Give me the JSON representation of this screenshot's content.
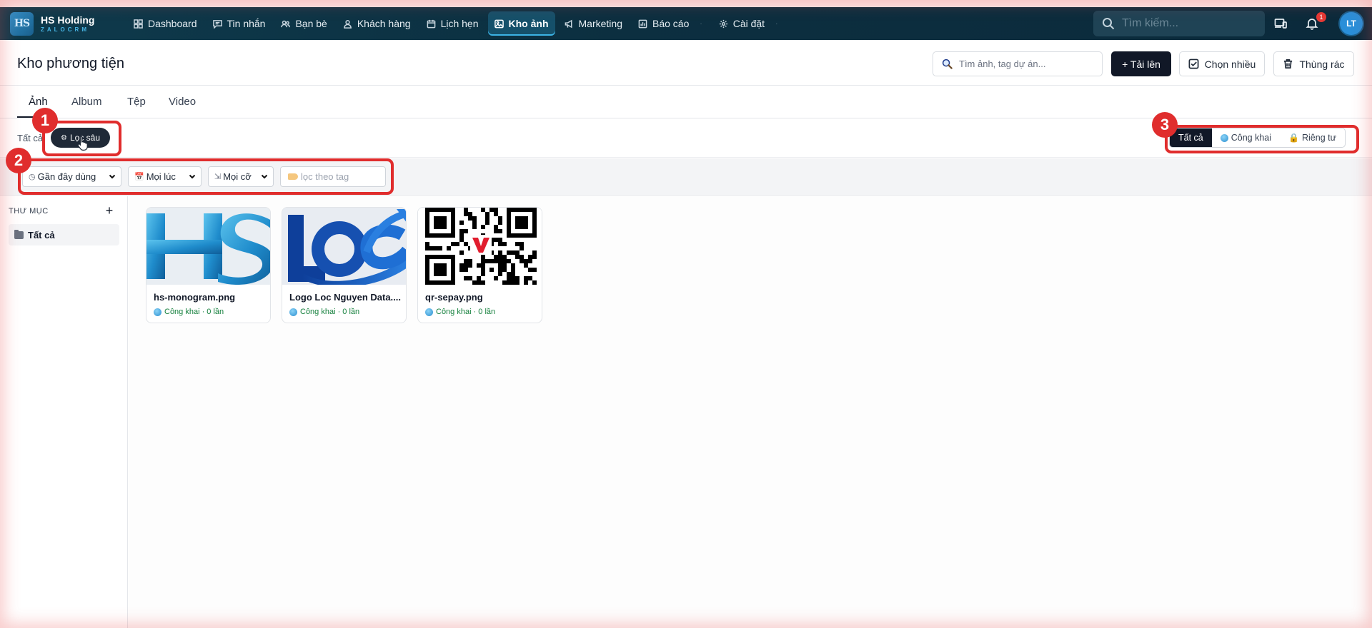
{
  "brand": {
    "logo_text": "HS",
    "name": "HS Holding",
    "sub": "ZALOCRM"
  },
  "nav": {
    "items": [
      {
        "label": "Dashboard",
        "icon": "grid-icon"
      },
      {
        "label": "Tin nhắn",
        "icon": "message-icon"
      },
      {
        "label": "Bạn bè",
        "icon": "friends-icon"
      },
      {
        "label": "Khách hàng",
        "icon": "user-icon"
      },
      {
        "label": "Lịch hẹn",
        "icon": "calendar-icon"
      },
      {
        "label": "Kho ảnh",
        "icon": "image-icon",
        "active": true
      },
      {
        "label": "Marketing",
        "icon": "megaphone-icon"
      },
      {
        "label": "Báo cáo",
        "icon": "chart-icon"
      },
      {
        "label": "Cài đặt",
        "icon": "gear-icon"
      }
    ],
    "search_placeholder": "Tìm kiếm...",
    "notification_count": "1",
    "avatar_initials": "LT"
  },
  "page": {
    "title": "Kho phương tiện",
    "search_placeholder": "Tìm ảnh, tag dự án...",
    "upload_label": "+ Tải lên",
    "multi_select_label": "Chọn nhiều",
    "trash_label": "Thùng rác"
  },
  "tabs": [
    "Ảnh",
    "Album",
    "Tệp",
    "Video"
  ],
  "filters": {
    "all_label": "Tất cả",
    "deep_filter_label": "Lọc sâu",
    "sort_value": "Gần đây dùng",
    "time_value": "Mọi lúc",
    "size_value": "Mọi cỡ",
    "tag_placeholder": "lọc theo tag",
    "visibility": [
      "Tất cả",
      "Công khai",
      "Riêng tư"
    ]
  },
  "annotations": [
    "1",
    "2",
    "3"
  ],
  "sidebar": {
    "title": "THƯ MỤC",
    "add": "+",
    "items": [
      "Tất cả"
    ]
  },
  "images": [
    {
      "name": "hs-monogram.png",
      "meta": "Công khai · 0 lần"
    },
    {
      "name": "Logo Loc Nguyen Data....",
      "meta": "Công khai · 0 lần"
    },
    {
      "name": "qr-sepay.png",
      "meta": "Công khai · 0 lần"
    }
  ],
  "colors": {
    "nav_bg": "#0c2f40",
    "accent": "#3cb3e5",
    "annotation": "#e02d2d",
    "dark_button": "#111827"
  }
}
